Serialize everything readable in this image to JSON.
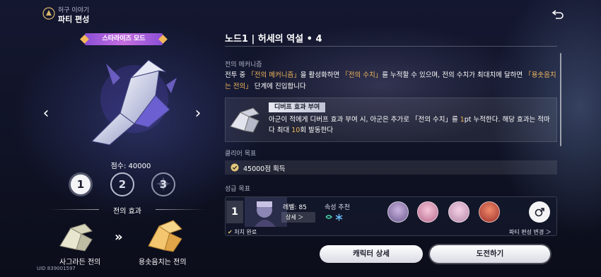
{
  "header": {
    "breadcrumb": "허구 이야기",
    "title": "파티 편성",
    "logo_icon": "feather-crest-icon",
    "back_icon": "return-arrow-icon"
  },
  "left": {
    "mode_badge": "스타라이즈 모드",
    "score": "점수: 40000",
    "stages": [
      "1",
      "2",
      "3"
    ],
    "selected_stage": "1",
    "effect_heading": "전의 효과",
    "effect_from": "사그라든 전의",
    "effect_to": "용솟음치는 전의",
    "uid": "UID 839001597"
  },
  "right": {
    "node_title": "노드1 | 허세의 역설 • 4",
    "mechanism_label": "전의 메커니즘",
    "mechanism_parts": {
      "p1": "전투 중 ",
      "h1": "「전의 메커니즘」",
      "p2": "을 활성화하면 ",
      "h2": "「전의 수치」",
      "p3": "를 누적할 수 있으며, 전의 수치가 최대치에 달하면 ",
      "h3": "「용솟음치는 전의」",
      "p4": " 단계에 진입합니다"
    },
    "debuff_tag": "디버프 효과 부여",
    "debuff_parts": {
      "p1": "아군이 적에게 디버프 효과 부여 시, 아군은 추가로 「전의 수치」를 ",
      "h1": "1",
      "p2": "pt 누적한다. 해당 효과는 적마다 최대 ",
      "h2": "10",
      "p3": "회 발동한다"
    },
    "clear_label": "클리어 목표",
    "clear_goal": "45000점 획득",
    "star_label": "성급 목표",
    "team": {
      "number": "1",
      "level": "레벨: 85",
      "detail": "상세 ＞",
      "attr_label": "속성 추천",
      "footer_left": "처치 완료",
      "footer_right": "파티 편성 변경 ＞"
    },
    "buttons": {
      "character_detail": "캐릭터 상세",
      "challenge": "도전하기"
    }
  },
  "colors": {
    "highlight": "#f2b85a",
    "mode_badge": "#c56fe0"
  }
}
